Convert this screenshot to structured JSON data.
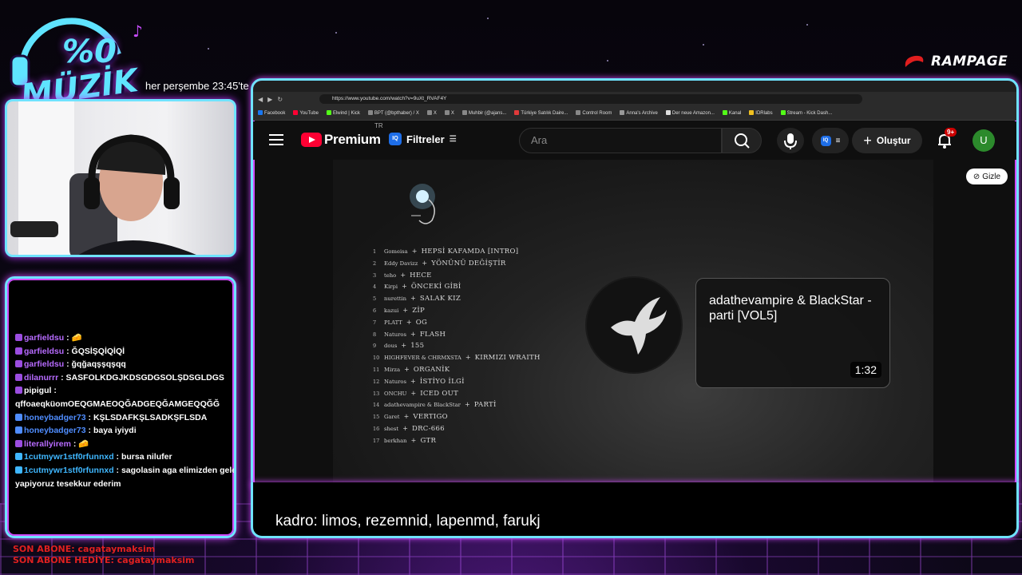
{
  "overlay": {
    "logo_line1": "%0",
    "logo_line2": "MÜZİK",
    "schedule": "her perşembe 23:45'te",
    "brand": "RAMPAGE",
    "caption": "kadro: limos, rezemnid, lapenmd, farukj",
    "last_sub": "SON ABONE: cagataymaksim",
    "last_gift": "SON ABONE HEDİYE: cagataymaksim"
  },
  "chat": {
    "messages": [
      {
        "user": "garfieldsu",
        "text": ": 🧀",
        "color": "purple"
      },
      {
        "user": "garfieldsu",
        "text": ": ĞQSİŞQİQİQİ",
        "color": "purple"
      },
      {
        "user": "garfieldsu",
        "text": ": ğqğaqşşqşqq",
        "color": "purple"
      },
      {
        "user": "dilanurrr",
        "text": ": SASFOLKDGJKDSGDGSOLŞDSGLDGS",
        "color": "purple"
      },
      {
        "user": "pipigul",
        "text": ":",
        "color": "white"
      },
      {
        "user": "",
        "text": "qffoaeqküomOEQGMAEOQĞADGEQĞAMGEQQĞĞ",
        "color": "white"
      },
      {
        "user": "honeybadger73",
        "text": ": KŞLSDAFKŞLSADKŞFLSDA",
        "color": "blue"
      },
      {
        "user": "honeybadger73",
        "text": ": baya iyiydi",
        "color": "blue"
      },
      {
        "user": "literallyirem",
        "text": ": 🧀",
        "color": "purple"
      },
      {
        "user": "1cutmywr1stf0rfunnxd",
        "text": ": bursa nilufer",
        "color": "cyan"
      },
      {
        "user": "1cutmywr1stf0rfunnxd",
        "text": ": sagolasin aga elimizden geleni",
        "color": "cyan"
      },
      {
        "user": "",
        "text": "yapiyoruz tesekkur ederim",
        "color": "white"
      }
    ]
  },
  "browser": {
    "url": "https://www.youtube.com/watch?v=9uXt_RVAF4Y",
    "bookmarks": [
      "Facebook",
      "YouTube",
      "Elwind | Kick",
      "BPT (@bpthaber) / X",
      "X",
      "X",
      "Muhbir (@ajans...",
      "Türkiye Satılık Daire...",
      "Control Room",
      "Anna's Archive",
      "Der neue Amazon...",
      "Kanal",
      "IDRlabs",
      "Stream - Kick Dash..."
    ]
  },
  "youtube": {
    "brand": "Premium",
    "region": "TR",
    "filters": "Filtreler",
    "search_placeholder": "Ara",
    "create": "Oluştur",
    "notifications": "9+",
    "avatar": "U",
    "hide": "Gizle"
  },
  "video": {
    "card_title": "adathevampire & BlackStar - parti [VOL5]",
    "card_time": "1:32",
    "tracklist": [
      {
        "n": "1",
        "artist": "Gomeisa",
        "title": "HEPSİ KAFAMDA [INTRO]"
      },
      {
        "n": "2",
        "artist": "Eddy Davizz",
        "title": "YÖNÜNÜ DEĞİŞTİR"
      },
      {
        "n": "3",
        "artist": "teho",
        "title": "HECE"
      },
      {
        "n": "4",
        "artist": "Kirpi",
        "title": "ÖNCEKİ GİBİ"
      },
      {
        "n": "5",
        "artist": "nurettin",
        "title": "SALAK KIZ"
      },
      {
        "n": "6",
        "artist": "kazui",
        "title": "ZİP"
      },
      {
        "n": "7",
        "artist": "PLATT",
        "title": "OG"
      },
      {
        "n": "8",
        "artist": "Naturos",
        "title": "FLASH"
      },
      {
        "n": "9",
        "artist": "dous",
        "title": "155"
      },
      {
        "n": "10",
        "artist": "HIGHFEVER & CHRMXSTA",
        "title": "KIRMIZI WRAITH"
      },
      {
        "n": "11",
        "artist": "Mirza",
        "title": "ORGANİK"
      },
      {
        "n": "12",
        "artist": "Naturos",
        "title": "İSTİYO İLGİ"
      },
      {
        "n": "13",
        "artist": "ONCHU",
        "title": "ICED OUT"
      },
      {
        "n": "14",
        "artist": "adathevampire & BlackStar",
        "title": "PARTİ"
      },
      {
        "n": "15",
        "artist": "Garet",
        "title": "VERTIGO"
      },
      {
        "n": "16",
        "artist": "shest",
        "title": "DRC-666"
      },
      {
        "n": "17",
        "artist": "berkhan",
        "title": "GTR"
      }
    ]
  }
}
